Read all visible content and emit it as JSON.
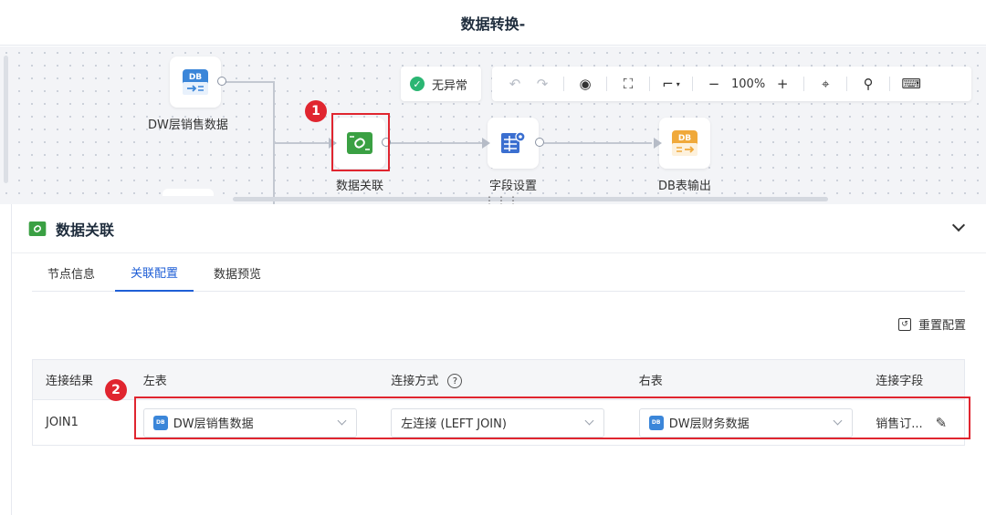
{
  "header": {
    "title": "数据转换-"
  },
  "canvas": {
    "nodes": {
      "dw_sales": {
        "label": "DW层销售数据",
        "icon": "db-input-icon",
        "icon_text": "DB"
      },
      "data_join": {
        "label": "数据关联",
        "icon": "link-icon"
      },
      "field_setting": {
        "label": "字段设置",
        "icon": "table-settings-icon"
      },
      "db_output": {
        "label": "DB表输出",
        "icon": "db-output-icon",
        "icon_text": "DB"
      }
    },
    "status": {
      "label": "无异常",
      "icon": "check-circle-icon"
    },
    "toolbar": {
      "zoom": "100%"
    },
    "badges": {
      "one": "1",
      "two": "2"
    }
  },
  "panel": {
    "title": "数据关联",
    "tabs": [
      {
        "label": "节点信息",
        "active": false
      },
      {
        "label": "关联配置",
        "active": true
      },
      {
        "label": "数据预览",
        "active": false
      }
    ],
    "reset_label": "重置配置",
    "table": {
      "headers": {
        "result": "连接结果",
        "left": "左表",
        "join_type": "连接方式",
        "right": "右表",
        "field": "连接字段"
      },
      "rows": [
        {
          "result": "JOIN1",
          "left": "DW层销售数据",
          "join_type": "左连接 (LEFT JOIN)",
          "right": "DW层财务数据",
          "field": "销售订..."
        }
      ]
    }
  },
  "colors": {
    "accent": "#1f5fd6",
    "highlight": "#e0252f",
    "ok": "#2bb673",
    "node_green": "#3aa043",
    "db_blue": "#3b86d9",
    "db_orange": "#f0a93a"
  }
}
